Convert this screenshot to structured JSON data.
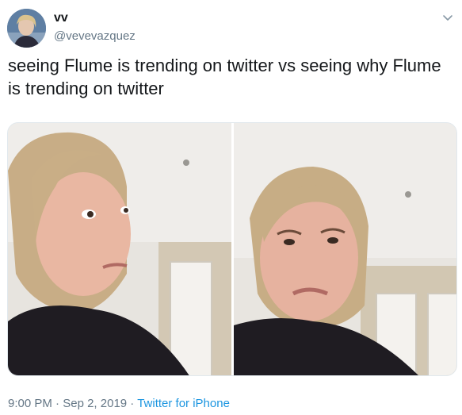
{
  "author": {
    "display_name": "vv",
    "handle": "@vevevazquez"
  },
  "tweet": {
    "text": "seeing Flume is trending on twitter vs seeing why Flume is trending on twitter"
  },
  "footer": {
    "time": "9:00 PM",
    "separator": "·",
    "date": "Sep 2, 2019",
    "source": "Twitter for iPhone"
  },
  "colors": {
    "text": "#14171a",
    "secondary": "#657786",
    "link": "#1b95e0",
    "border": "#e1e8ed"
  }
}
